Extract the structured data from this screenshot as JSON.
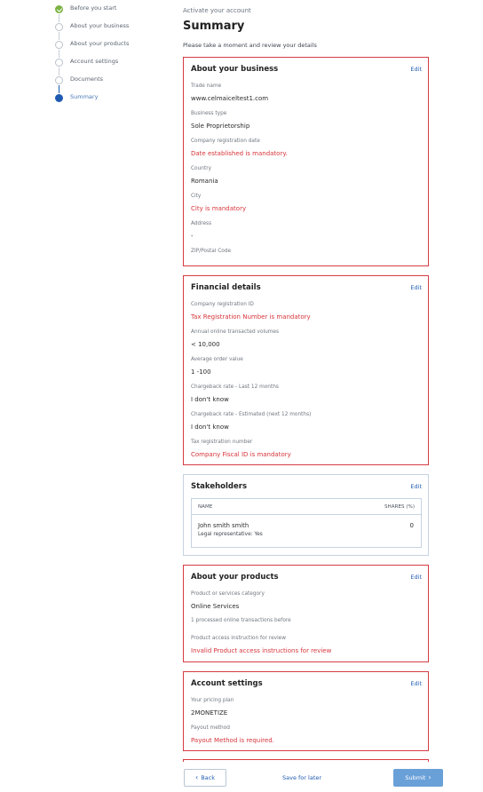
{
  "stepper": {
    "steps": [
      {
        "label": "Before you start",
        "state": "done"
      },
      {
        "label": "About your business",
        "state": "todo"
      },
      {
        "label": "About your products",
        "state": "todo"
      },
      {
        "label": "Account settings",
        "state": "todo"
      },
      {
        "label": "Documents",
        "state": "todo"
      },
      {
        "label": "Summary",
        "state": "active"
      }
    ]
  },
  "header": {
    "eyebrow": "Activate your account",
    "title": "Summary",
    "intro": "Please take a moment and review your details"
  },
  "business": {
    "title": "About your business",
    "edit": "Edit",
    "fields": [
      {
        "label": "Trade name",
        "value": "www.celmaiceltest1.com",
        "error": false
      },
      {
        "label": "Business type",
        "value": "Sole Proprietorship",
        "error": false
      },
      {
        "label": "Company registration date",
        "value": "Date established is mandatory.",
        "error": true
      },
      {
        "label": "Country",
        "value": "Romania",
        "error": false
      },
      {
        "label": "City",
        "value": "City is mandatory",
        "error": true
      },
      {
        "label": "Address",
        "value": "-",
        "error": false
      },
      {
        "label": "ZIP/Postal Code",
        "value": "",
        "error": false
      }
    ]
  },
  "financial": {
    "title": "Financial details",
    "edit": "Edit",
    "fields": [
      {
        "label": "Company registration ID",
        "value": "Tax Registration Number is mandatory",
        "error": true
      },
      {
        "label": "Annual online transacted volumes",
        "value": "< 10,000",
        "error": false
      },
      {
        "label": "Average order value",
        "value": "1 -100",
        "error": false
      },
      {
        "label": "Chargeback rate - Last 12 months",
        "value": "I don't know",
        "error": false
      },
      {
        "label": "Chargeback rate - Estimated (next 12 months)",
        "value": "I don't know",
        "error": false
      },
      {
        "label": "Tax registration number",
        "value": "Company Fiscal ID is mandatory",
        "error": true
      }
    ]
  },
  "stakeholders": {
    "title": "Stakeholders",
    "edit": "Edit",
    "col_name": "NAME",
    "col_shares": "SHARES (%)",
    "rows": [
      {
        "name": "John smith smith",
        "rep": "Legal representative:  Yes",
        "shares": "0"
      }
    ]
  },
  "products": {
    "title": "About your products",
    "edit": "Edit",
    "category_label": "Product or services category",
    "category_value": "Online Services",
    "transactions_note": "1 processed online transactions before",
    "access_label": "Product access instruction for review",
    "access_value": "Invalid Product access instructions for review"
  },
  "account": {
    "title": "Account settings",
    "edit": "Edit",
    "plan_label": "Your pricing plan",
    "plan_value": "2MONETIZE",
    "payout_label": "Payout method",
    "payout_value": "Payout Method is required."
  },
  "footer": {
    "back": "Back",
    "save": "Save for later",
    "submit": "Submit"
  },
  "colors": {
    "accent": "#1e5ab0",
    "error": "#d73c42",
    "done": "#7cb342",
    "submit_bg": "#6aa0d8"
  }
}
